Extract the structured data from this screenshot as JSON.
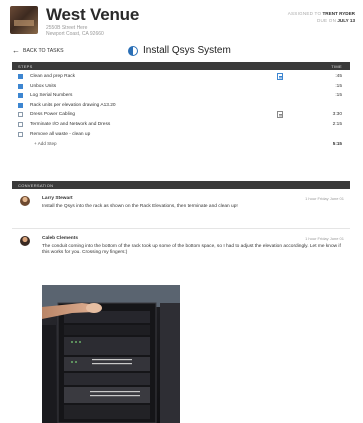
{
  "venue": {
    "name": "West Venue",
    "address_line1": "2550B Street Here",
    "address_line2": "Newport Coast, CA 92660"
  },
  "assignment": {
    "assigned_label": "ASSIGNED TO",
    "assigned_value": "TRENT RYDER",
    "due_label": "DUE ON",
    "due_value": "JULY 13"
  },
  "nav": {
    "back_label": "BACK TO TASKS"
  },
  "task": {
    "title": "Install Qsys System"
  },
  "steps_table": {
    "col_steps": "STEPS",
    "col_time": "TIME",
    "rows": [
      {
        "label": "Clean and prep Rack",
        "checked": true,
        "has_doc": true,
        "doc_color": "blue",
        "time": ":45"
      },
      {
        "label": "Unbox Units",
        "checked": true,
        "has_doc": false,
        "time": ":15"
      },
      {
        "label": "Log Serial Numbers",
        "checked": true,
        "has_doc": false,
        "time": ":15"
      },
      {
        "label": "Rack units per elevation drawing A13.20",
        "checked": true,
        "has_doc": false,
        "time": ""
      },
      {
        "label": "Dress Power Cabling",
        "checked": false,
        "has_doc": true,
        "doc_color": "gray",
        "time": "3:30"
      },
      {
        "label": "Terminate I/O and Network and Dress",
        "checked": false,
        "has_doc": false,
        "time": "2:15"
      },
      {
        "label": "Remove all waste - clean up",
        "checked": false,
        "has_doc": false,
        "time": ""
      }
    ],
    "add_label": "+ Add Step",
    "total_time": "5:15"
  },
  "conversation": {
    "header": "CONVERSATION",
    "messages": [
      {
        "author": "Larry Stewart",
        "timestamp": "1 hour Friday June 01",
        "text": "Install the Qsys into the rack as shown on the Rack Elevations, then terminate and clean up!"
      },
      {
        "author": "Caleb Clements",
        "timestamp": "1 hour Friday June 01",
        "text": "The conduit coming into the bottom of the rack took up some of the bottom space, so I had to adjust the elevation accordingly. Let me know if this works for you. Crossing my fingers:)"
      }
    ]
  },
  "colors": {
    "accent": "#3d86d1",
    "header_bar": "#3a3a3a"
  }
}
